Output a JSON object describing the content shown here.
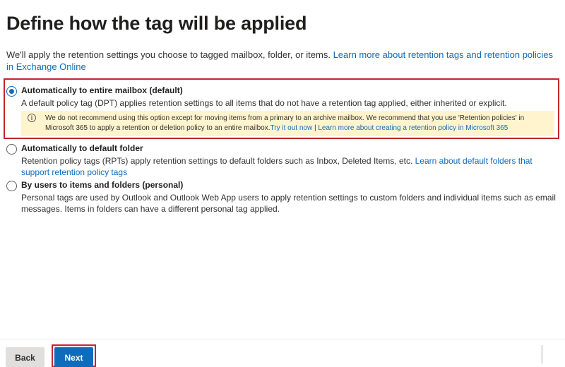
{
  "page": {
    "title": "Define how the tag will be applied",
    "intro_text": "We'll apply the retention settings you choose to tagged mailbox, folder, or items. ",
    "intro_link": "Learn more about retention tags and retention policies in Exchange Online"
  },
  "options": [
    {
      "label": "Automatically to entire mailbox (default)",
      "description": "A default policy tag (DPT) applies retention settings to all items that do not have a retention tag applied, either inherited or explicit.",
      "checked": true
    },
    {
      "label": "Automatically to default folder",
      "description": "Retention policy tags (RPTs) apply retention settings to default folders such as Inbox, Deleted Items, etc. ",
      "link": "Learn about default folders that support retention policy tags",
      "checked": false
    },
    {
      "label": "By users to items and folders (personal)",
      "description": "Personal tags are used by Outlook and Outlook Web App users to apply retention settings to custom folders and individual items such as email messages. Items in folders can have a different personal tag applied.",
      "checked": false
    }
  ],
  "warning": {
    "icon": "info-icon",
    "text": "We do not recommend using this option except for moving items from a primary to an archive mailbox. We recommend that you use 'Retention policies' in Microsoft 365 to apply a retention or deletion policy to an entire mailbox.",
    "link1": "Try it out now",
    "separator": " | ",
    "link2": "Learn more about creating a retention policy in Microsoft 365",
    "background": "#fff4ce"
  },
  "footer": {
    "back_label": "Back",
    "next_label": "Next"
  },
  "colors": {
    "accent": "#0f6cbd",
    "highlight": "#c4262e"
  }
}
